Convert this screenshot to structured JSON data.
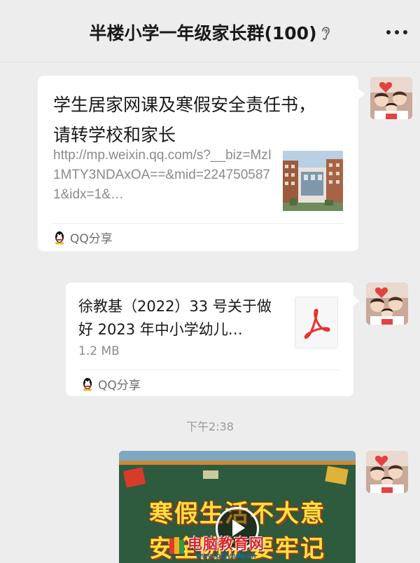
{
  "header": {
    "title": "半楼小学一年级家长群(100)",
    "ear_icon": "earpiece-mode-icon",
    "more_icon": "more-options-icon"
  },
  "messages": {
    "link_card": {
      "title": "学生居家网课及寒假安全责任书，请转学校和家长",
      "description": "http://mp.weixin.qq.com/s?__biz=MzI1MTY3NDAxOA==&mid=2247505871&idx=1&…",
      "source_label": "QQ分享",
      "source_icon": "qq-penguin-icon"
    },
    "file_card": {
      "file_name": "徐教基（2022）33 号关于做好 2023 年中小学幼儿…",
      "file_size": "1.2 MB",
      "file_icon": "pdf-icon",
      "source_label": "QQ分享",
      "source_icon": "qq-penguin-icon"
    },
    "timestamp": "下午2:38",
    "video": {
      "line1": "寒假生活不大意",
      "line2": "安全防护要牢记",
      "play_icon": "play-icon"
    }
  },
  "watermark": {
    "text": "电脑教育网",
    "url": "www.pcjyedu.cn"
  },
  "colors": {
    "background": "#ededed",
    "bubble": "#ffffff",
    "secondary_text": "#8a8a8a",
    "video_board": "#2f5a3c",
    "video_text": "#ffe23d"
  }
}
